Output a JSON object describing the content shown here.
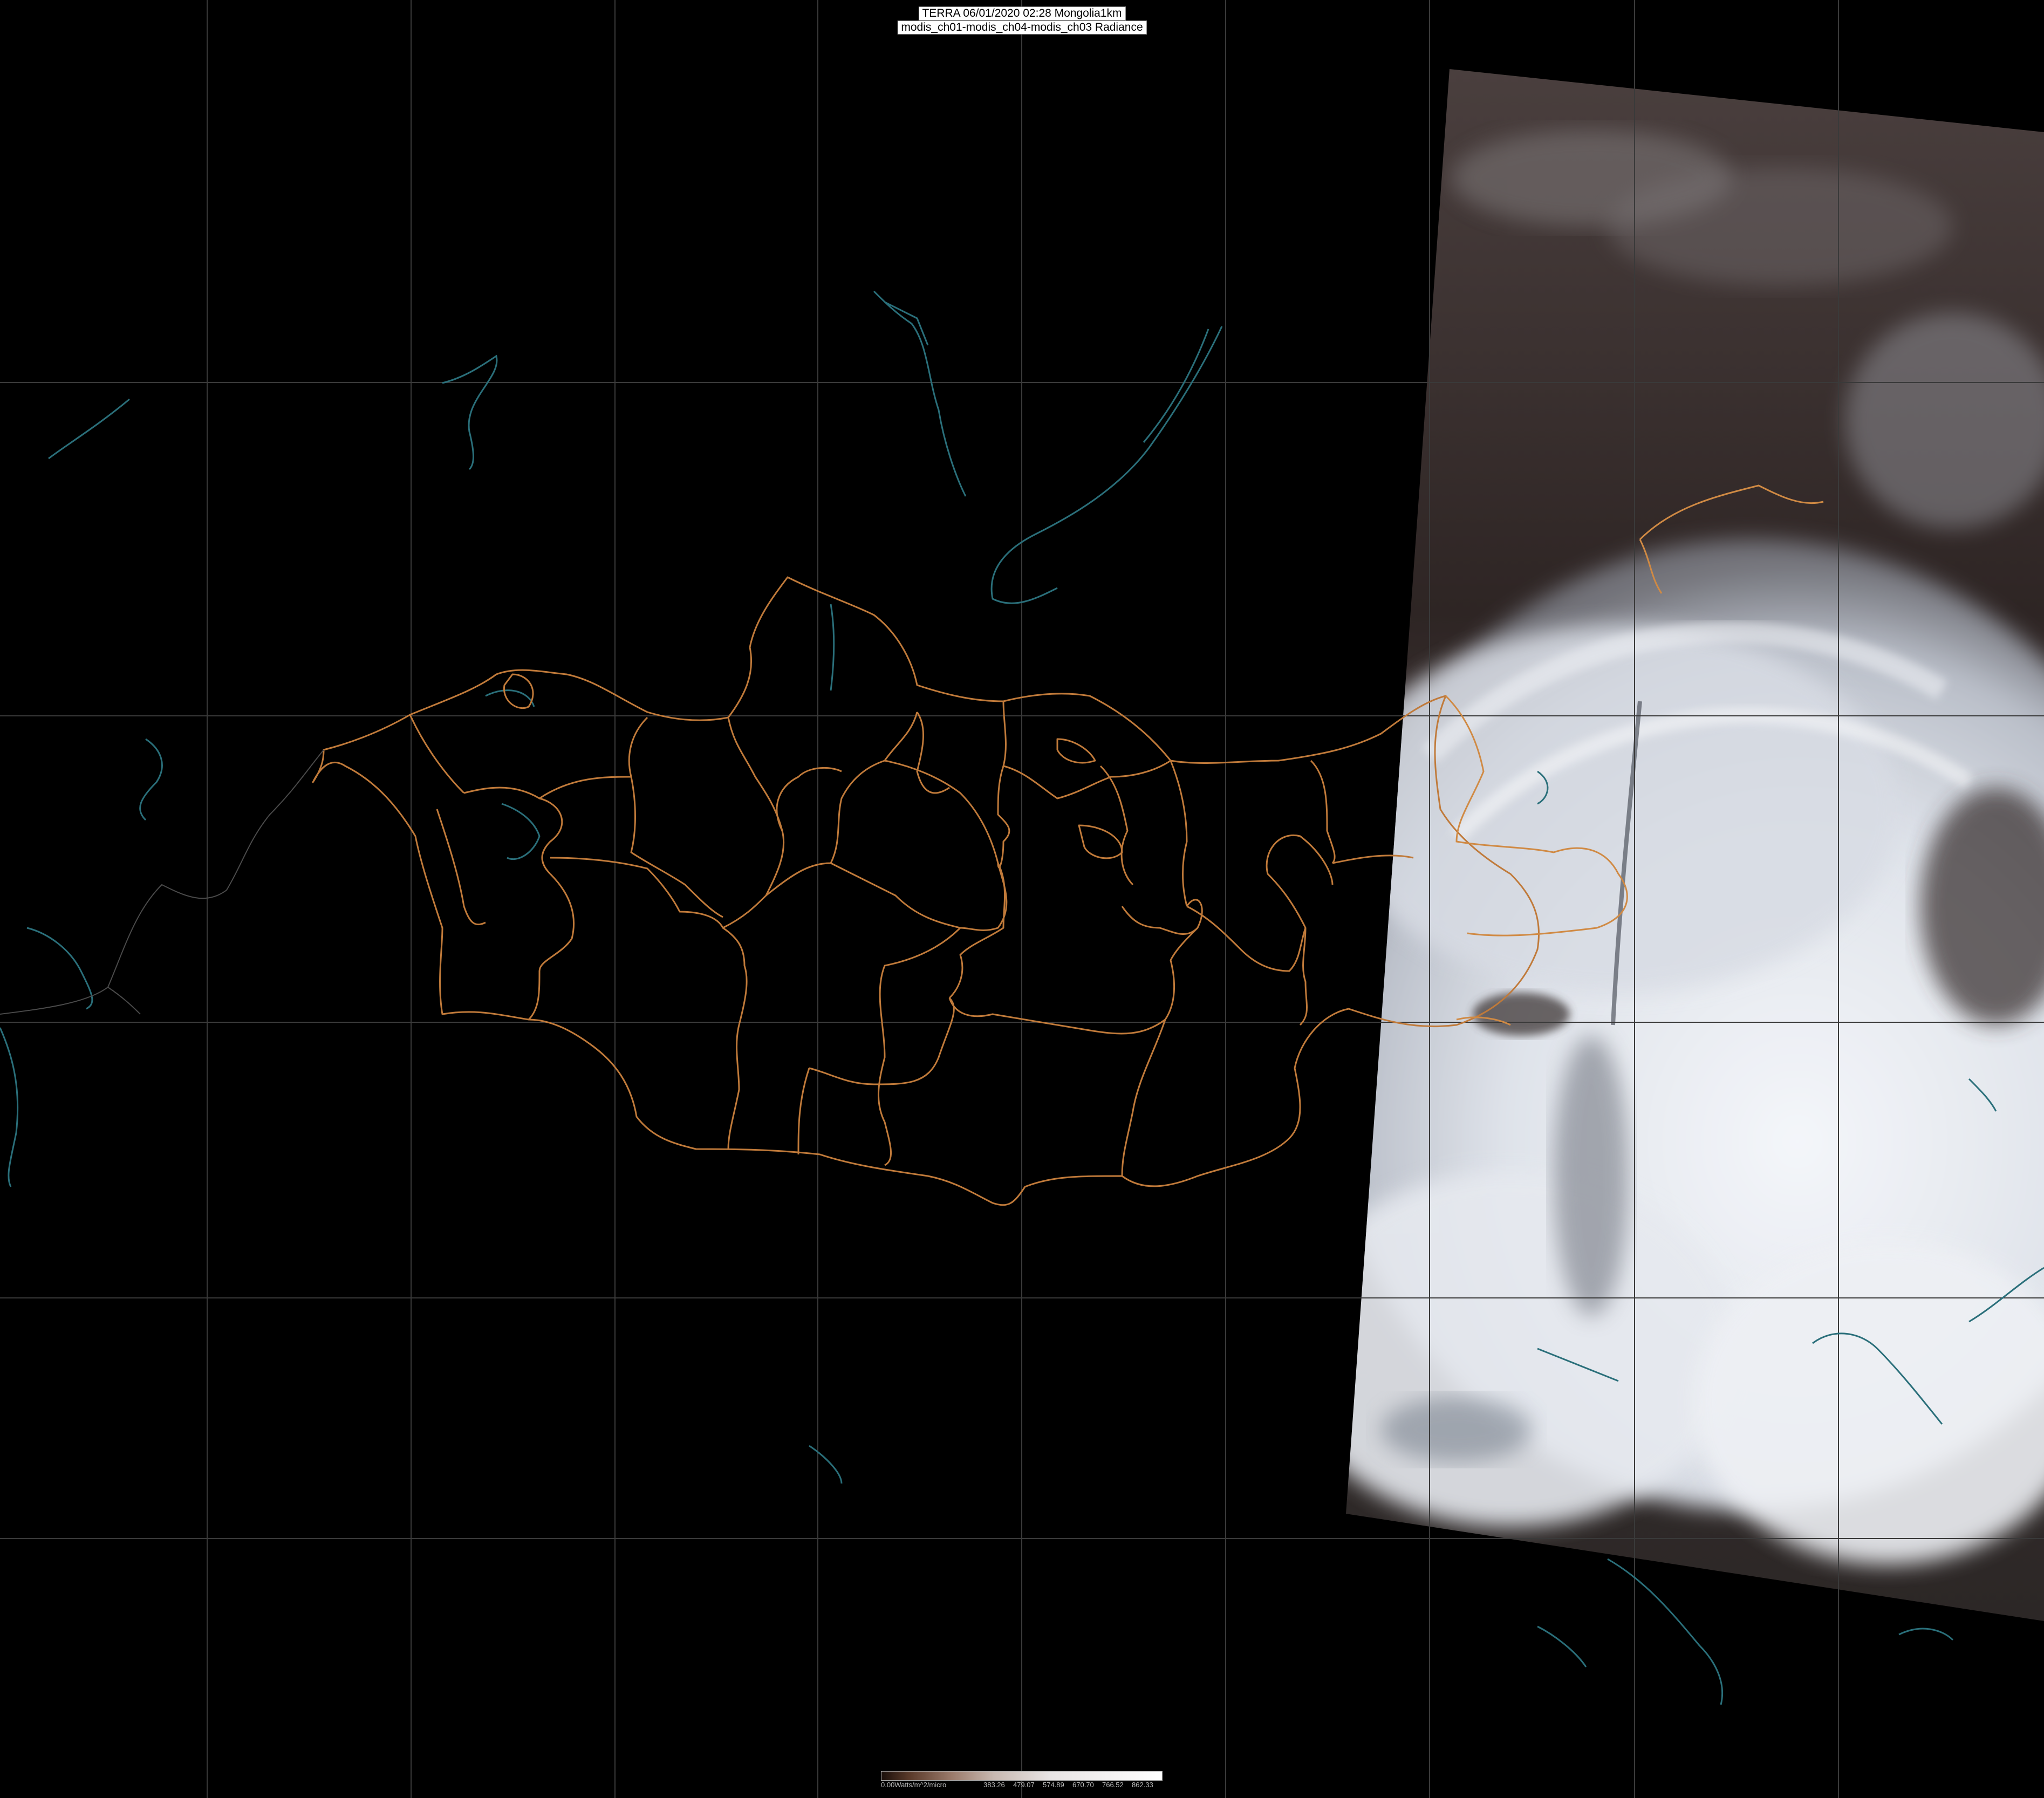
{
  "title": {
    "line1": "TERRA 06/01/2020 02:28 Mongolia1km",
    "line2": "modis_ch01-modis_ch04-modis_ch03 Radiance"
  },
  "legend": {
    "unit_label": "0.00Watts/m^2/micro",
    "ticks": [
      "383.26",
      "479.07",
      "574.89",
      "670.70",
      "766.52",
      "862.33"
    ]
  },
  "colors": {
    "background": "#000000",
    "grid": "#3a3a3a",
    "province_border": "#c07a3a",
    "water": "#2a6f7a",
    "cloud": "#e8ecf2",
    "land_dark": "#3a2e2c"
  }
}
